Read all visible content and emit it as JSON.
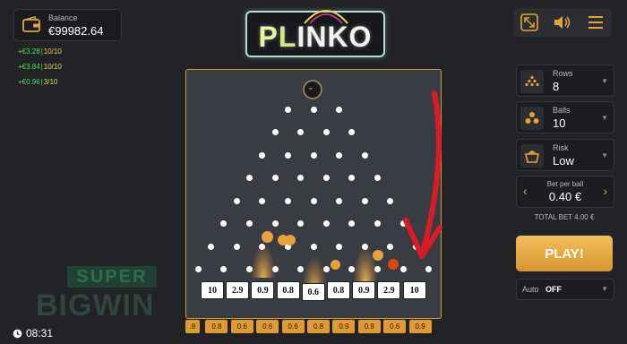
{
  "balance": {
    "label": "Balance",
    "value": "€99982.64"
  },
  "history": [
    {
      "amount": "+€3.28",
      "ratio": "10/10"
    },
    {
      "amount": "+€3.84",
      "ratio": "10/10"
    },
    {
      "amount": "+€0.96",
      "ratio": "3/10"
    }
  ],
  "logo": {
    "text": "PLINKO"
  },
  "controls": {
    "rows": {
      "label": "Rows",
      "value": "8"
    },
    "balls": {
      "label": "Balls",
      "value": "10"
    },
    "risk": {
      "label": "Risk",
      "value": "Low"
    },
    "bet": {
      "label": "Bet per ball",
      "value": "0.40 €"
    },
    "total_bet": "TOTAL BET 4.00 €",
    "play": "PLAY!",
    "auto": {
      "label": "Auto",
      "value": "OFF"
    }
  },
  "buckets": [
    "10",
    "2.9",
    "0.9",
    "0.8",
    "0.6",
    "0.8",
    "0.9",
    "2.9",
    "10"
  ],
  "strip": [
    ".8",
    "0.8",
    "0.6",
    "0.6",
    "0.6",
    "0.8",
    "0.9",
    "0.9",
    "0.6",
    "0.9"
  ],
  "watermark": {
    "top": "SUPER",
    "bottom": "BIGWIN"
  },
  "clock": "08:31",
  "colors": {
    "accent": "#e09a32",
    "board": "#3a3c44",
    "arrow": "#d81b25",
    "history_green": "#49e05a"
  }
}
